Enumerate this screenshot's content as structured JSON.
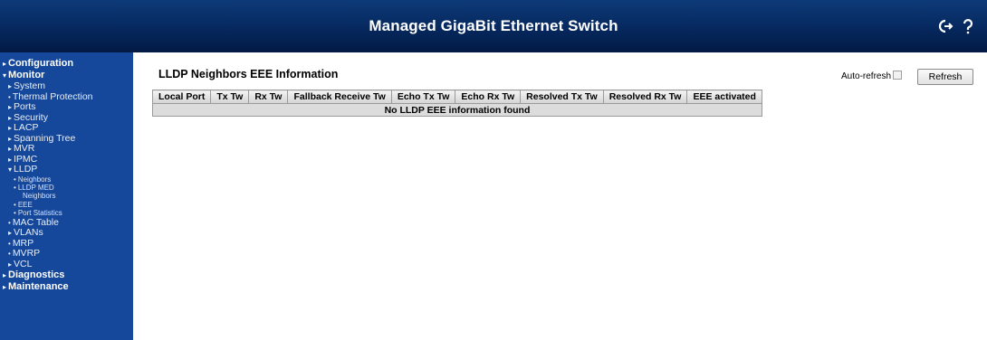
{
  "header": {
    "title": "Managed GigaBit Ethernet Switch",
    "logout_icon": "logout-icon",
    "help_icon": "help-icon"
  },
  "sidebar": {
    "items": [
      {
        "label": "Configuration",
        "level": 1
      },
      {
        "label": "Monitor",
        "level": 1
      },
      {
        "label": "System",
        "level": 2
      },
      {
        "label": "Thermal Protection",
        "level": 2
      },
      {
        "label": "Ports",
        "level": 2
      },
      {
        "label": "Security",
        "level": 2
      },
      {
        "label": "LACP",
        "level": 2
      },
      {
        "label": "Spanning Tree",
        "level": 2
      },
      {
        "label": "MVR",
        "level": 2
      },
      {
        "label": "IPMC",
        "level": 2
      },
      {
        "label": "LLDP",
        "level": 2
      },
      {
        "label": "Neighbors",
        "level": 3
      },
      {
        "label": "LLDP MED",
        "level": 3
      },
      {
        "label": "Neighbors",
        "level": 3
      },
      {
        "label": "EEE",
        "level": 3
      },
      {
        "label": "Port Statistics",
        "level": 3
      },
      {
        "label": "MAC Table",
        "level": 2
      },
      {
        "label": "VLANs",
        "level": 2
      },
      {
        "label": "MRP",
        "level": 2
      },
      {
        "label": "MVRP",
        "level": 2
      },
      {
        "label": "VCL",
        "level": 2
      },
      {
        "label": "Diagnostics",
        "level": 1
      },
      {
        "label": "Maintenance",
        "level": 1
      }
    ]
  },
  "main": {
    "title": "LLDP Neighbors EEE Information",
    "auto_refresh_label": "Auto-refresh",
    "auto_refresh_checked": false,
    "refresh_label": "Refresh",
    "table": {
      "headers": [
        "Local Port",
        "Tx Tw",
        "Rx Tw",
        "Fallback Receive Tw",
        "Echo Tx Tw",
        "Echo Rx Tw",
        "Resolved Tx Tw",
        "Resolved Rx Tw",
        "EEE activated"
      ],
      "empty_message": "No LLDP EEE information found"
    }
  },
  "colors": {
    "header_bg": "#06285e",
    "sidebar_bg": "#15489a",
    "table_header_bg": "#d4d4d4",
    "table_row_bg": "#dcdcdc"
  }
}
